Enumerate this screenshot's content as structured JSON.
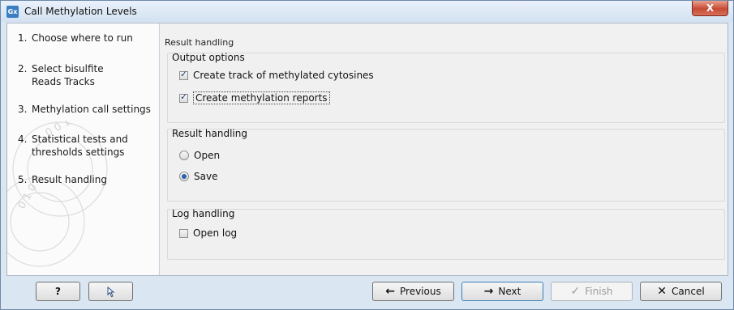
{
  "window": {
    "title": "Call Methylation Levels",
    "app_icon_text": "Gx",
    "close_symbol": "X"
  },
  "steps": [
    {
      "num": "1.",
      "label": "Choose where to run"
    },
    {
      "num": "2.",
      "label": "Select bisulfite Reads Tracks"
    },
    {
      "num": "3.",
      "label": "Methylation call settings"
    },
    {
      "num": "4.",
      "label": "Statistical tests and thresholds settings"
    },
    {
      "num": "5.",
      "label": "Result handling"
    }
  ],
  "main": {
    "heading": "Result handling",
    "output_options": {
      "title": "Output options",
      "create_track": {
        "label": "Create track of methylated cytosines",
        "checked": true
      },
      "create_reports": {
        "label": "Create methylation reports",
        "checked": true
      }
    },
    "result_handling": {
      "title": "Result handling",
      "open": {
        "label": "Open",
        "selected": false
      },
      "save": {
        "label": "Save",
        "selected": true
      }
    },
    "log_handling": {
      "title": "Log handling",
      "open_log": {
        "label": "Open log",
        "checked": false
      }
    }
  },
  "buttons": {
    "help": "?",
    "reset_icon": "reset-icon",
    "previous": "Previous",
    "next": "Next",
    "finish": "Finish",
    "cancel": "Cancel"
  }
}
